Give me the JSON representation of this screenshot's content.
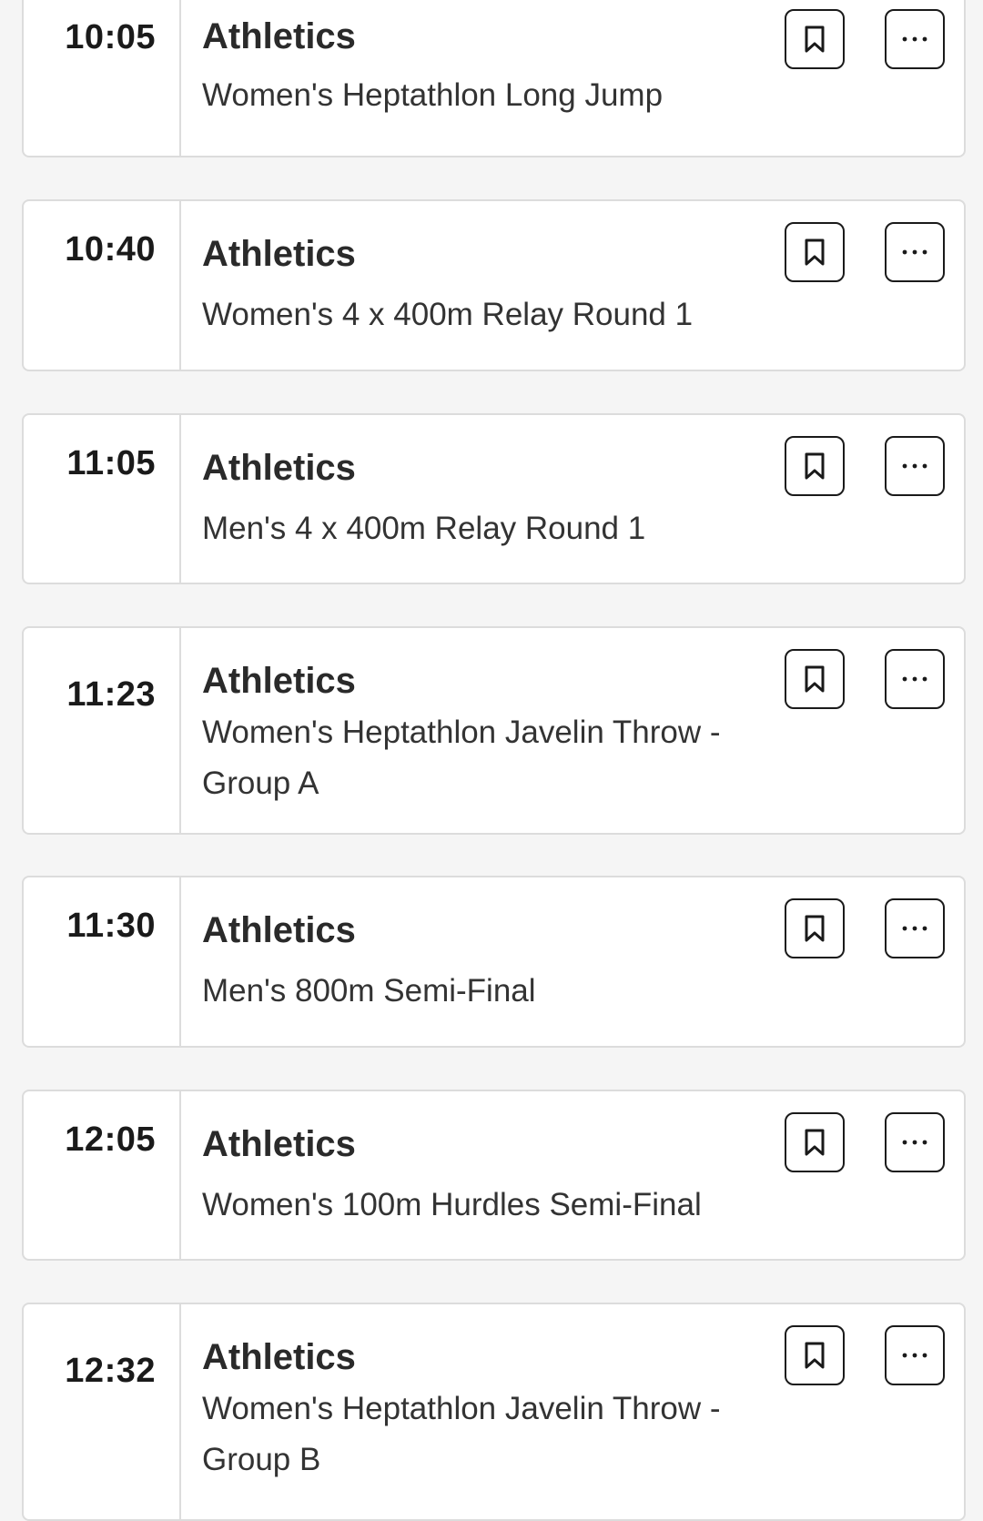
{
  "events": [
    {
      "time": "10:05",
      "sport": "Athletics",
      "event": "Women's Heptathlon Long Jump",
      "bookmark_icon": "bookmark-icon",
      "more_icon": "more-options-icon"
    },
    {
      "time": "10:40",
      "sport": "Athletics",
      "event": "Women's 4 x 400m Relay Round 1",
      "bookmark_icon": "bookmark-icon",
      "more_icon": "more-options-icon"
    },
    {
      "time": "11:05",
      "sport": "Athletics",
      "event": "Men's 4 x 400m Relay Round 1",
      "bookmark_icon": "bookmark-icon",
      "more_icon": "more-options-icon"
    },
    {
      "time": "11:23",
      "sport": "Athletics",
      "event": "Women's Heptathlon Javelin Throw - Group A",
      "bookmark_icon": "bookmark-icon",
      "more_icon": "more-options-icon"
    },
    {
      "time": "11:30",
      "sport": "Athletics",
      "event": "Men's 800m Semi-Final",
      "bookmark_icon": "bookmark-icon",
      "more_icon": "more-options-icon"
    },
    {
      "time": "12:05",
      "sport": "Athletics",
      "event": "Women's 100m Hurdles Semi-Final",
      "bookmark_icon": "bookmark-icon",
      "more_icon": "more-options-icon"
    },
    {
      "time": "12:32",
      "sport": "Athletics",
      "event": "Women's Heptathlon Javelin Throw - Group B",
      "bookmark_icon": "bookmark-icon",
      "more_icon": "more-options-icon"
    }
  ],
  "colors": {
    "background": "#f5f5f5",
    "card": "#ffffff",
    "border": "#dcdcdc",
    "text": "#1a1a1a"
  }
}
